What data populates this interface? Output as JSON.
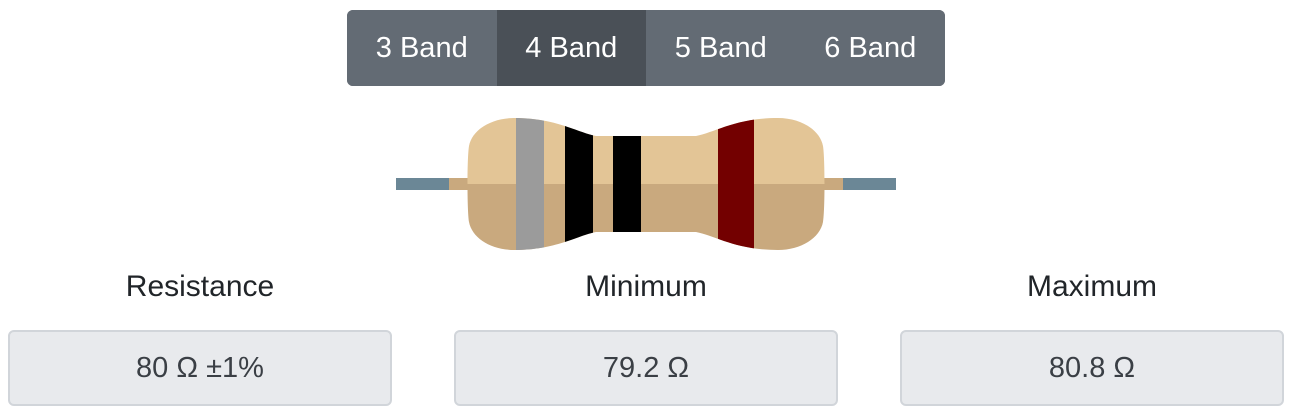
{
  "band_selector": {
    "options": [
      {
        "label": "3 Band",
        "active": false
      },
      {
        "label": "4 Band",
        "active": true
      },
      {
        "label": "5 Band",
        "active": false
      },
      {
        "label": "6 Band",
        "active": false
      }
    ]
  },
  "resistor": {
    "bands": [
      {
        "color_name": "gray",
        "color": "#9b9b9b"
      },
      {
        "color_name": "black",
        "color": "#000000"
      },
      {
        "color_name": "black",
        "color": "#000000"
      },
      {
        "color_name": "brown",
        "color": "#730000"
      }
    ],
    "body_color": "#e3c596",
    "body_shade_color": "#c9a97e",
    "lead_color": "#6b8796",
    "lead_stub_color": "#c9a97e"
  },
  "results": {
    "resistance": {
      "label": "Resistance",
      "value": "80 Ω ±1%"
    },
    "minimum": {
      "label": "Minimum",
      "value": "79.2 Ω"
    },
    "maximum": {
      "label": "Maximum",
      "value": "80.8 Ω"
    }
  },
  "colors": {
    "toggle_bg": "#636b74",
    "toggle_active_bg": "#4a5057",
    "box_bg": "#e8eaed",
    "box_border": "#d1d5da"
  }
}
